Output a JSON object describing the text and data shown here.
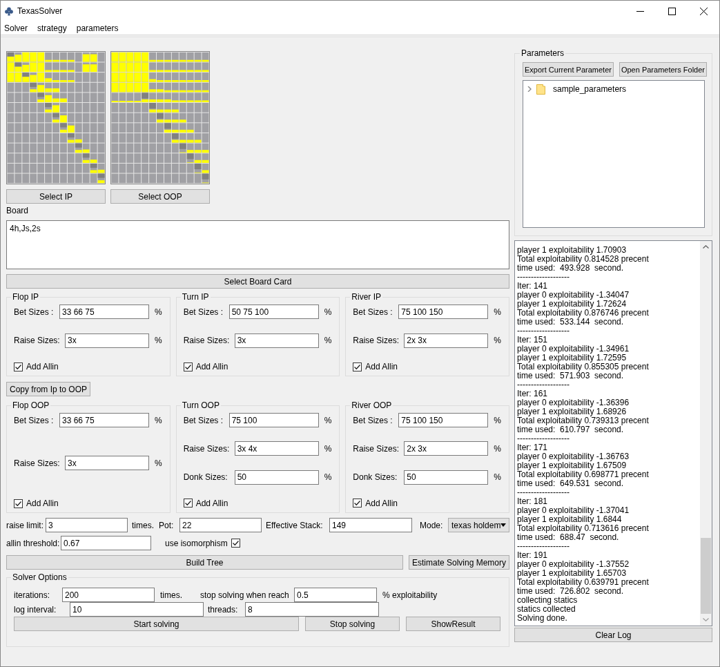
{
  "window": {
    "title": "TexasSolver"
  },
  "menu": [
    {
      "label": "Solver"
    },
    {
      "label": "strategy"
    },
    {
      "label": "parameters"
    }
  ],
  "ranges": [
    {
      "button": "Select IP",
      "kind": "ip"
    },
    {
      "button": "Select OOP",
      "kind": "oop"
    }
  ],
  "board": {
    "label": "Board",
    "value": "4h,Js,2s",
    "button": "Select Board Card"
  },
  "ip_groups": [
    {
      "title": "Flop IP",
      "fields": [
        {
          "label": "Bet Sizes :",
          "value": "33 66 75",
          "unit": "%"
        },
        {
          "label": "Raise Sizes:",
          "value": "3x",
          "unit": "%"
        }
      ],
      "allin": {
        "label": "Add Allin",
        "checked": true
      }
    },
    {
      "title": "Turn IP",
      "fields": [
        {
          "label": "Bet Sizes :",
          "value": "50 75 100",
          "unit": "%"
        },
        {
          "label": "Raise Sizes:",
          "value": "3x",
          "unit": "%"
        }
      ],
      "allin": {
        "label": "Add Allin",
        "checked": true
      }
    },
    {
      "title": "River IP",
      "fields": [
        {
          "label": "Bet Sizes :",
          "value": "75 100 150",
          "unit": "%"
        },
        {
          "label": "Raise Sizes:",
          "value": "2x 3x",
          "unit": "%"
        }
      ],
      "allin": {
        "label": "Add Allin",
        "checked": true
      }
    }
  ],
  "copy_button": "Copy from Ip to OOP",
  "oop_groups": [
    {
      "title": "Flop OOP",
      "fields": [
        {
          "label": "Bet Sizes :",
          "value": "33 66 75",
          "unit": "%"
        },
        {
          "label": "Raise Sizes:",
          "value": "3x",
          "unit": "%"
        }
      ],
      "allin": {
        "label": "Add Allin",
        "checked": true
      }
    },
    {
      "title": "Turn OOP",
      "fields": [
        {
          "label": "Bet Sizes :",
          "value": "75 100",
          "unit": "%"
        },
        {
          "label": "Raise Sizes:",
          "value": "3x 4x",
          "unit": "%"
        },
        {
          "label": "Donk Sizes:",
          "value": "50",
          "unit": "%"
        }
      ],
      "allin": {
        "label": "Add Allin",
        "checked": true
      }
    },
    {
      "title": "River OOP",
      "fields": [
        {
          "label": "Bet Sizes :",
          "value": "75 100 150",
          "unit": "%"
        },
        {
          "label": "Raise Sizes:",
          "value": "2x 3x",
          "unit": "%"
        },
        {
          "label": "Donk Sizes:",
          "value": "50",
          "unit": "%"
        }
      ],
      "allin": {
        "label": "Add Allin",
        "checked": true
      }
    }
  ],
  "tree": {
    "raise_limit": {
      "label": "raise limit:",
      "value": "3",
      "unit": "times."
    },
    "pot": {
      "label": "Pot:",
      "value": "22"
    },
    "stack": {
      "label": "Effective Stack:",
      "value": "149"
    },
    "mode": {
      "label": "Mode:",
      "value": "texas holdem"
    },
    "allin_threshold": {
      "label": "allin threshold:",
      "value": "0.67"
    },
    "isomorphism": {
      "label": "use isomorphism",
      "checked": true
    },
    "build_button": "Build Tree",
    "estimate_button": "Estimate Solving Memory"
  },
  "solver_options": {
    "title": "Solver Options",
    "iterations": {
      "label": "iterations:",
      "value": "200",
      "unit": "times."
    },
    "stop": {
      "label": "stop solving when reach",
      "value": "0.5",
      "unit": "% exploitability"
    },
    "log_interval": {
      "label": "log interval:",
      "value": "10"
    },
    "threads": {
      "label": "threads:",
      "value": "8"
    },
    "buttons": [
      "Start solving",
      "Stop solving",
      "ShowResult"
    ]
  },
  "parameters": {
    "title": "Parameters",
    "buttons": [
      "Export Current Parameter",
      "Open Parameters Folder"
    ],
    "tree": [
      {
        "label": "sample_parameters",
        "expanded": false
      }
    ]
  },
  "log": [
    "player 1 exploitability 1.70903",
    "Total exploitability 0.814528 precent",
    "time used:  493.928  second.",
    "-------------------",
    "Iter: 141",
    "player 0 exploitability -1.34047",
    "player 1 exploitability 1.72624",
    "Total exploitability 0.876746 precent",
    "time used:  533.144  second.",
    "-------------------",
    "Iter: 151",
    "player 0 exploitability -1.34961",
    "player 1 exploitability 1.72595",
    "Total exploitability 0.855305 precent",
    "time used:  571.903  second.",
    "-------------------",
    "Iter: 161",
    "player 0 exploitability -1.36396",
    "player 1 exploitability 1.68926",
    "Total exploitability 0.739313 precent",
    "time used:  610.797  second.",
    "-------------------",
    "Iter: 171",
    "player 0 exploitability -1.36763",
    "player 1 exploitability 1.67509",
    "Total exploitability 0.698771 precent",
    "time used:  649.531  second.",
    "-------------------",
    "Iter: 181",
    "player 0 exploitability -1.37041",
    "player 1 exploitability 1.6844",
    "Total exploitability 0.713616 precent",
    "time used:  688.47  second.",
    "-------------------",
    "Iter: 191",
    "player 0 exploitability -1.37552",
    "player 1 exploitability 1.65703",
    "Total exploitability 0.639791 precent",
    "time used:  726.802  second.",
    "collecting statics",
    "statics collected",
    "Solving done."
  ],
  "clear_log_button": "Clear Log"
}
